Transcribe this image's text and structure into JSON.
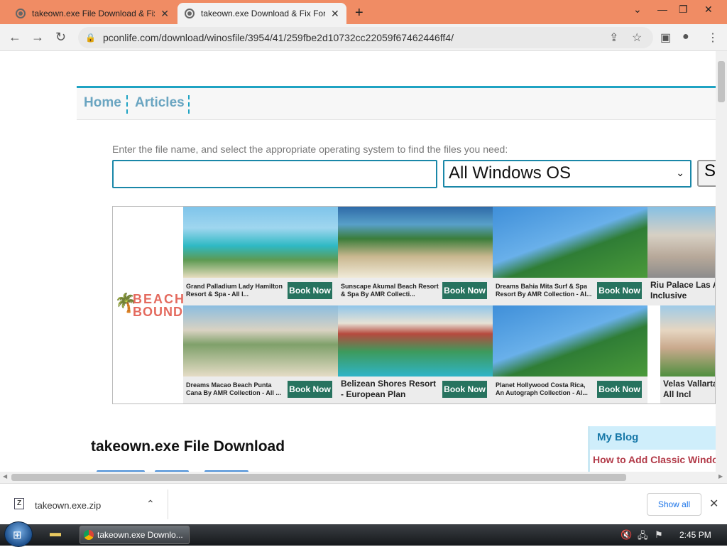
{
  "browser": {
    "tabs": [
      {
        "title": "takeown.exe File Download & Fix"
      },
      {
        "title": "takeown.exe Download & Fix For"
      }
    ],
    "url": "pconlife.com/download/winosfile/3954/41/259fbe2d10732cc22059f67462446ff4/"
  },
  "site": {
    "nav": [
      "Home",
      "Articles"
    ],
    "search_hint": "Enter the file name, and select the appropriate operating system to find the files you need:",
    "os_select": "All Windows OS",
    "search_button": "S"
  },
  "ad": {
    "brand_line1": "BEACH",
    "brand_line2": "BOUND",
    "book_label": "Book Now",
    "cards": [
      {
        "name": "Grand Palladium Lady Hamilton Resort & Spa - All I..."
      },
      {
        "name": "Sunscape Akumal Beach Resort & Spa By AMR Collecti..."
      },
      {
        "name": "Dreams Bahia Mita Surf & Spa Resort By AMR Collection - Al..."
      },
      {
        "name": "Riu Palace Las A - All Inclusive"
      },
      {
        "name": "Dreams Macao Beach Punta Cana By AMR Collection - All ..."
      },
      {
        "name": "Belizean Shores Resort - European Plan"
      },
      {
        "name": "Planet Hollywood Costa Rica, An Autograph Collection - Al..."
      },
      {
        "name": "Velas Vallarta S Resort - All Incl"
      }
    ]
  },
  "content": {
    "title": "takeown.exe File Download",
    "blog_heading": "My Blog",
    "blog_item": "How to Add Classic Windo"
  },
  "download_bar": {
    "file": "takeown.exe.zip",
    "show_all": "Show all"
  },
  "taskbar": {
    "task_title": "takeown.exe Downlo...",
    "time": "2:45 PM"
  }
}
